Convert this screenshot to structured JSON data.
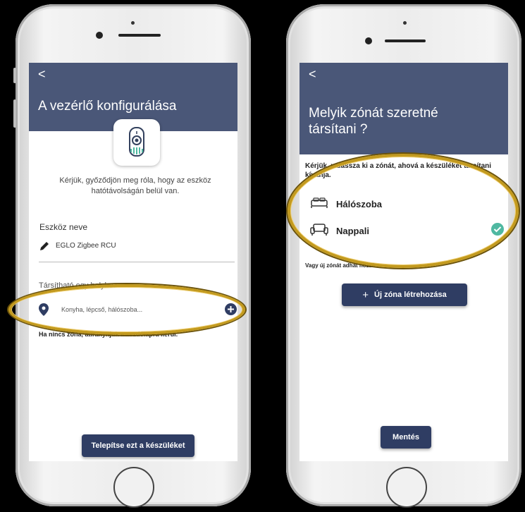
{
  "left": {
    "back": "<",
    "title": "A vezérlő konfigurálása",
    "hint": "Kérjük, győződjön meg róla, hogy az eszköz hatótávolságán belül van.",
    "device_name_label": "Eszköz neve",
    "device_name_value": "EGLO Zigbee RCU",
    "assign_label": "Társítható egy helyhez",
    "location_placeholder": "Konyha, lépcső, hálószoba...",
    "note": "Ha nincs zóna, átirányítjuk a kezdőlapra kerül.",
    "install_button": "Telepítse ezt a készüléket"
  },
  "right": {
    "back": "<",
    "title": "Melyik zónát szeretné társítani ?",
    "hint": "Kérjük, válassza ki a zónát, ahová a készüléket társítani kívánja.",
    "zones": [
      {
        "label": "Hálószoba",
        "icon": "bed-icon",
        "selected": false
      },
      {
        "label": "Nappali",
        "icon": "sofa-icon",
        "selected": true
      }
    ],
    "new_zone_prefix": "Vagy új zónát adhat hozzá",
    "new_zone_button": "Új zóna létrehozása",
    "new_zone_plus": "+",
    "save_button": "Mentés"
  },
  "colors": {
    "header": "#4a5778",
    "button": "#2f3d63",
    "check": "#4fb8a1",
    "annotation": "#c39a1e"
  }
}
